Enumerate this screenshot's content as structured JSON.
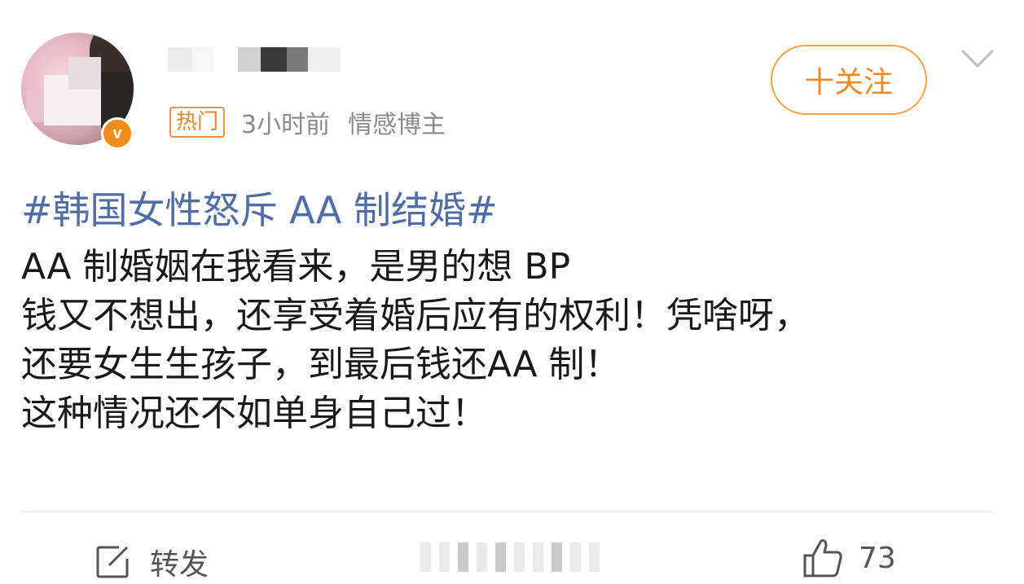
{
  "post": {
    "author": {
      "verified_badge": "v"
    },
    "meta": {
      "hot_badge": "热门",
      "time": "3小时前",
      "role": "情感博主"
    },
    "follow_label": "十关注",
    "hashtag": "#韩国女性怒斥 AA 制结婚#",
    "body_lines": [
      "AA 制婚姻在我看来，是男的想 BP",
      "钱又不想出，还享受着婚后应有的权利！凭啥呀，",
      "还要女生生孩子，到最后钱还AA 制！",
      "这种情况还不如单身自己过！"
    ]
  },
  "footer": {
    "repost_label": "转发",
    "like_count": "73"
  },
  "colors": {
    "accent_orange": "#ec8a24",
    "hashtag_blue": "#4f6ea8",
    "muted_text": "#8a8a8a"
  },
  "icons": {
    "repost": "share-edit-icon",
    "like": "thumbs-up-icon",
    "more": "chevron-down-icon"
  }
}
